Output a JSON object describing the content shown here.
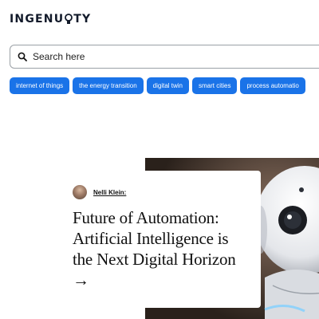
{
  "header": {
    "logo_text_left": "INGENU",
    "logo_text_right": "TY"
  },
  "search": {
    "placeholder": "Search here"
  },
  "tags": [
    {
      "label": "internet of things"
    },
    {
      "label": "the energy transition"
    },
    {
      "label": "digital twin"
    },
    {
      "label": "smart cities"
    },
    {
      "label": "process automatio"
    }
  ],
  "article": {
    "author": "Nelli Klein:",
    "headline": "Future of Automation: Artificial Intelligence is the Next Digital Horizon →"
  },
  "colors": {
    "tag_background": "#1a73e8",
    "logo": "#121a2a"
  }
}
